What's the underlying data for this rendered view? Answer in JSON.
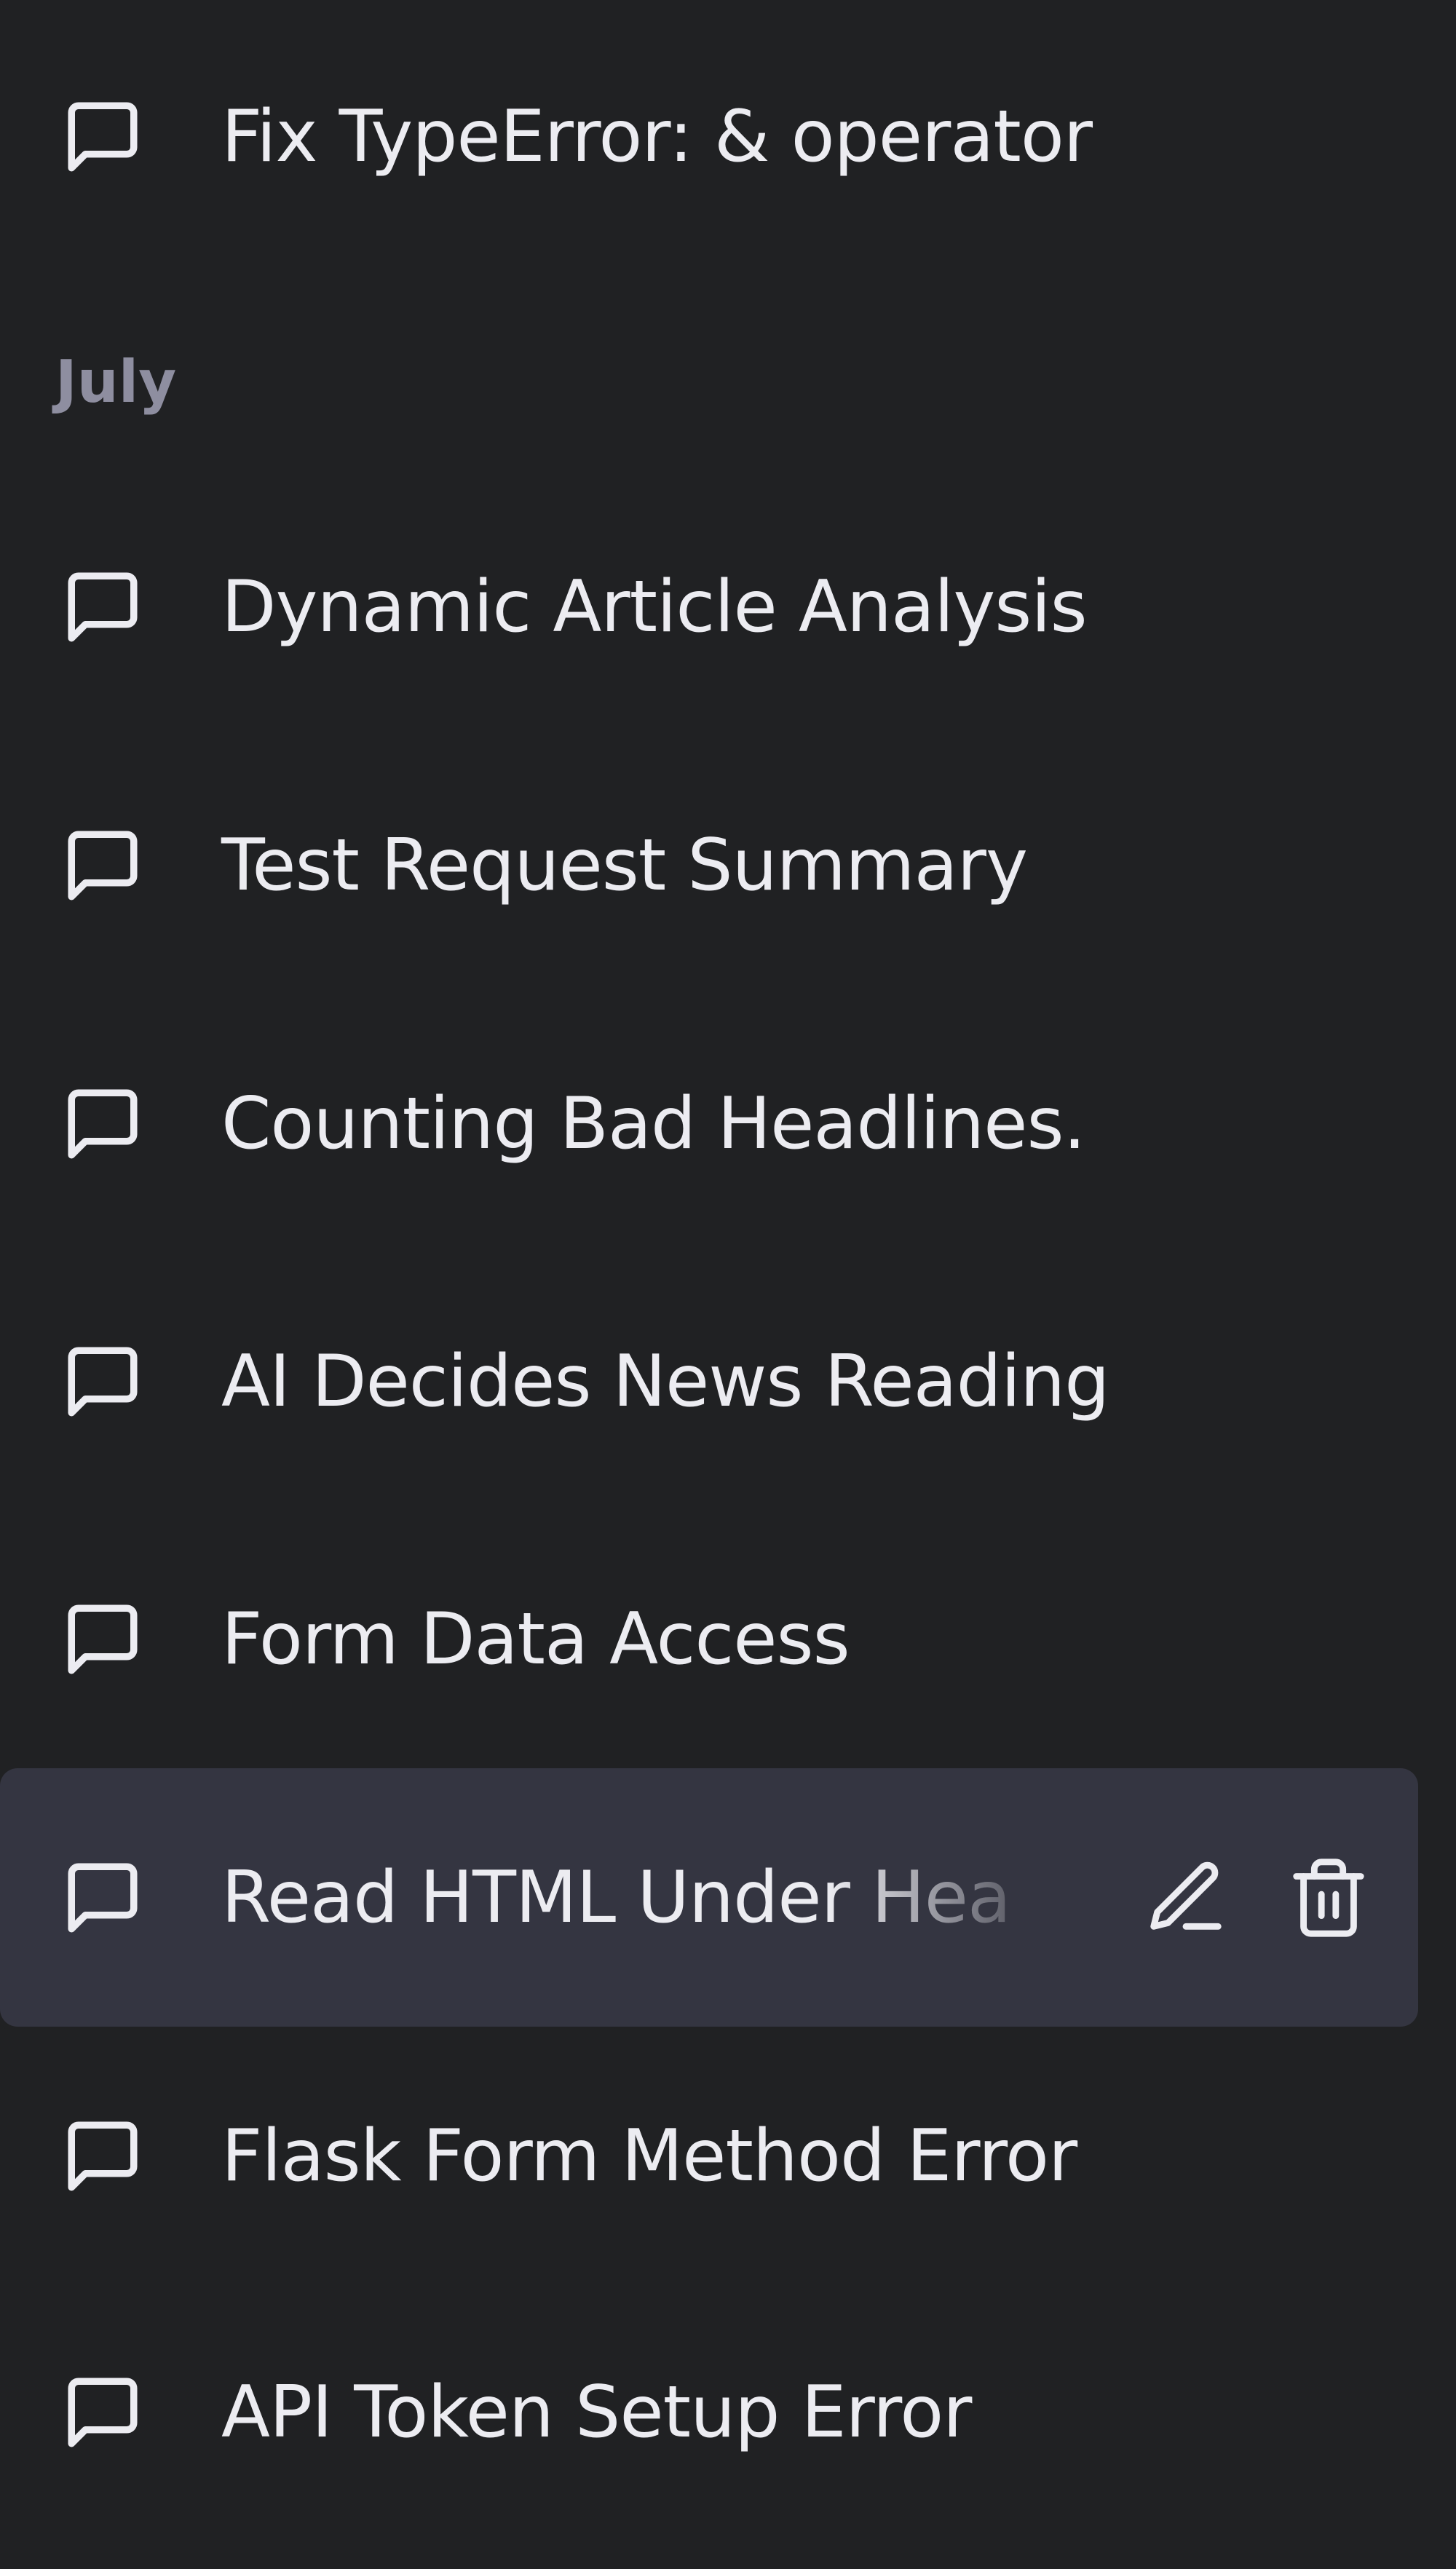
{
  "sidebar": {
    "top_items": [
      {
        "label": "Fix TypeError: & operator",
        "icon": "chat-bubble-icon"
      }
    ],
    "sections": [
      {
        "title": "July",
        "items": [
          {
            "label": "Dynamic Article Analysis",
            "icon": "chat-bubble-icon"
          },
          {
            "label": "Test Request Summary",
            "icon": "chat-bubble-icon"
          },
          {
            "label": "Counting Bad Headlines.",
            "icon": "chat-bubble-icon"
          },
          {
            "label": "AI Decides News Reading",
            "icon": "chat-bubble-icon"
          },
          {
            "label": "Form Data Access",
            "icon": "chat-bubble-icon"
          },
          {
            "label": "Read HTML Under Hea",
            "icon": "chat-bubble-icon",
            "active": true,
            "actions": [
              "edit-pencil-icon",
              "delete-trash-icon"
            ]
          },
          {
            "label": "Flask Form Method Error",
            "icon": "chat-bubble-icon"
          },
          {
            "label": "API Token Setup Error",
            "icon": "chat-bubble-icon"
          }
        ]
      }
    ]
  },
  "colors": {
    "background": "#202123",
    "active_background": "#343541",
    "text": "#ececf1",
    "section_title": "#8e8ea0",
    "icon": "#ececf1"
  }
}
